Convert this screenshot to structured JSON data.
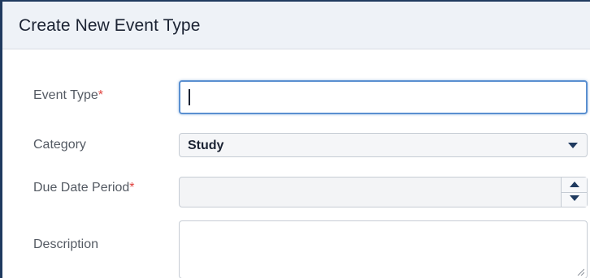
{
  "dialog": {
    "title": "Create New Event Type"
  },
  "form": {
    "event_type": {
      "label": "Event Type",
      "required_mark": "*",
      "value": ""
    },
    "category": {
      "label": "Category",
      "selected": "Study"
    },
    "due_date_period": {
      "label": "Due Date Period",
      "required_mark": "*",
      "value": ""
    },
    "description": {
      "label": "Description",
      "value": ""
    }
  },
  "colors": {
    "required": "#e0433f",
    "focus_border": "#5a8fd0",
    "header_bg": "#eef2f7"
  },
  "icons": {
    "category_dropdown": "chevron-down-icon",
    "spinner_up": "arrow-up-icon",
    "spinner_down": "arrow-down-icon",
    "description_resize": "resize-handle-icon"
  }
}
